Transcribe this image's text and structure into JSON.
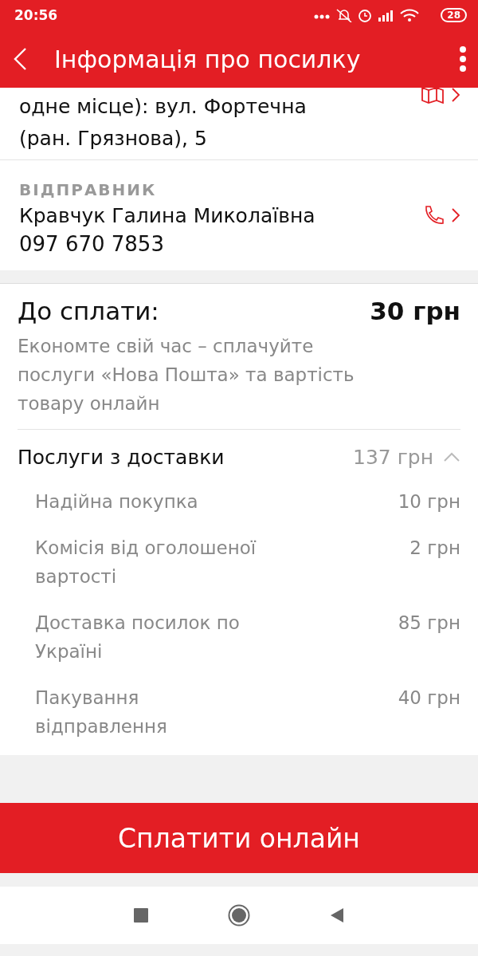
{
  "status_bar": {
    "time": "20:56",
    "battery": "28"
  },
  "app_bar": {
    "title": "Інформація про посилку"
  },
  "address": {
    "lines": [
      "одне місце): вул. Фортечна",
      "(ран. Грязнова), 5"
    ]
  },
  "sender": {
    "label": "ВІДПРАВНИК",
    "name": "Кравчук Галина Миколаївна",
    "phone": "097 670 7853"
  },
  "payment": {
    "label": "До сплати:",
    "amount": "30 грн",
    "note": "Економте свій час – сплачуйте послуги «Нова Пошта» та вартість товару онлайн",
    "services": {
      "label": "Послуги з доставки",
      "total": "137 грн",
      "expanded": true,
      "items": [
        {
          "name": "Надійна покупка",
          "price": "10 грн"
        },
        {
          "name": "Комісія від оголошеної вартості",
          "price": "2 грн"
        },
        {
          "name": "Доставка посилок по Україні",
          "price": "85 грн"
        },
        {
          "name": "Пакування відправлення",
          "price": "40 грн"
        }
      ]
    }
  },
  "pay_button": "Сплатити онлайн"
}
